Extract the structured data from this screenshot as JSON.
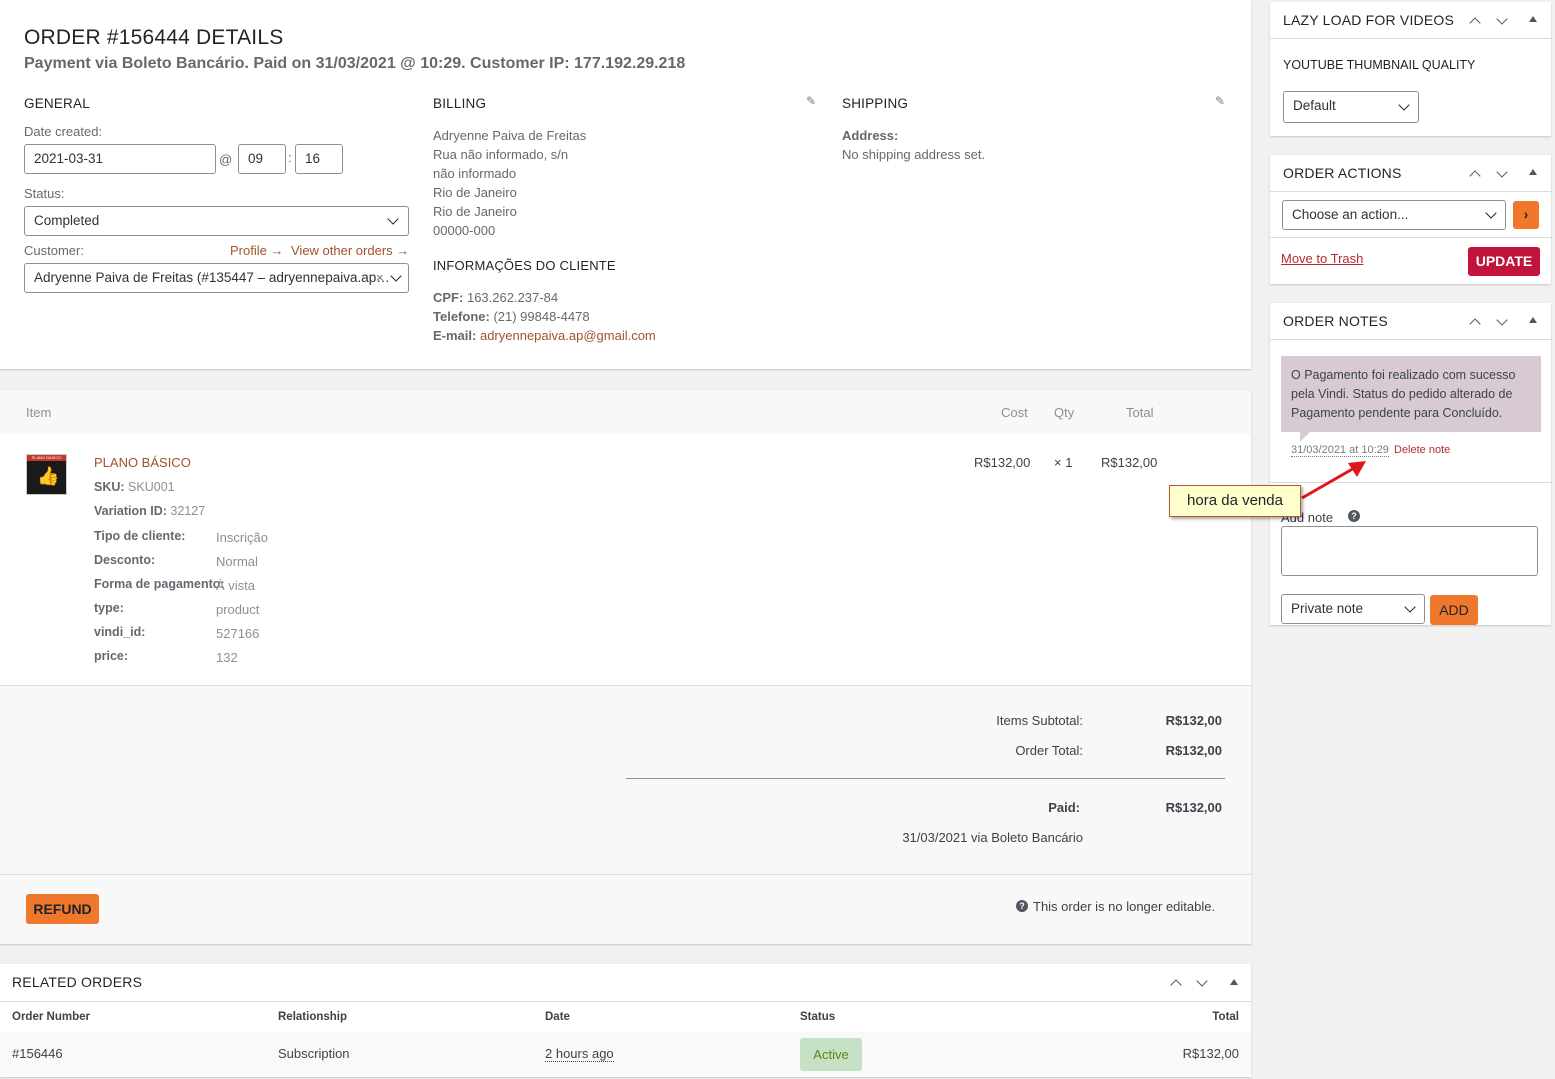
{
  "order": {
    "title": "ORDER #156444 DETAILS",
    "subtitle": "Payment via Boleto Bancário. Paid on 31/03/2021 @ 10:29. Customer IP: 177.192.29.218"
  },
  "general": {
    "heading": "GENERAL",
    "date_label": "Date created:",
    "date_value": "2021-03-31",
    "at": "@",
    "hour": "09",
    "colon": ":",
    "minute": "16",
    "status_label": "Status:",
    "status_value": "Completed",
    "customer_label": "Customer:",
    "profile_link": "Profile →",
    "other_orders_link": "View other orders →",
    "customer_value": "Adryenne Paiva de Freitas (#135447 – adryennepaiva.ap…",
    "clear": "×"
  },
  "billing": {
    "heading": "BILLING",
    "lines": [
      "Adryenne Paiva de Freitas",
      "Rua não informado, s/n",
      "não informado",
      "Rio de Janeiro",
      "Rio de Janeiro",
      "00000-000"
    ],
    "client_heading": "INFORMAÇÕES DO CLIENTE",
    "cpf_label": "CPF:",
    "cpf_value": "163.262.237-84",
    "phone_label": "Telefone:",
    "phone_value": "(21) 99848-4478",
    "email_label": "E-mail:",
    "email_value": "adryennepaiva.ap@gmail.com"
  },
  "shipping": {
    "heading": "SHIPPING",
    "address_label": "Address:",
    "address_value": "No shipping address set."
  },
  "items": {
    "headers": {
      "item": "Item",
      "cost": "Cost",
      "qty": "Qty",
      "total": "Total"
    },
    "product": {
      "name": "PLANO BÁSICO",
      "thumb_text": "PLANO BÁSICO",
      "sku_label": "SKU:",
      "sku": "SKU001",
      "variation_label": "Variation ID:",
      "variation": "32127",
      "cost": "R$132,00",
      "qty": "× 1",
      "total": "R$132,00",
      "meta": [
        {
          "key": "Tipo de cliente:",
          "value": "Inscrição"
        },
        {
          "key": "Desconto:",
          "value": "Normal"
        },
        {
          "key": "Forma de pagamento:",
          "value": "À vista"
        },
        {
          "key": "type:",
          "value": "product"
        },
        {
          "key": "vindi_id:",
          "value": "527166"
        },
        {
          "key": "price:",
          "value": "132"
        }
      ]
    },
    "totals": {
      "subtotal_label": "Items Subtotal:",
      "subtotal": "R$132,00",
      "order_total_label": "Order Total:",
      "order_total": "R$132,00",
      "paid_label": "Paid:",
      "paid": "R$132,00",
      "paid_note": "31/03/2021 via Boleto Bancário"
    },
    "refund_label": "REFUND",
    "not_editable": "This order is no longer editable."
  },
  "related": {
    "heading": "RELATED ORDERS",
    "headers": {
      "number": "Order Number",
      "relationship": "Relationship",
      "date": "Date",
      "status": "Status",
      "total": "Total"
    },
    "row": {
      "number": "#156446",
      "relationship": "Subscription",
      "date": "2 hours ago",
      "status": "Active",
      "total": "R$132,00"
    }
  },
  "sidebar": {
    "lazy": {
      "heading": "LAZY LOAD FOR VIDEOS",
      "label": "YOUTUBE THUMBNAIL QUALITY",
      "value": "Default"
    },
    "actions": {
      "heading": "ORDER ACTIONS",
      "select": "Choose an action...",
      "trash": "Move to Trash",
      "update": "UPDATE"
    },
    "notes": {
      "heading": "ORDER NOTES",
      "note_text": "O Pagamento foi realizado com sucesso pela Vindi. Status do pedido alterado de Pagamento pendente para Concluído.",
      "note_time": "31/03/2021 at 10:29",
      "delete": "Delete note",
      "add_label": "Add note",
      "type": "Private note",
      "add_btn": "ADD"
    }
  },
  "annotation": {
    "callout": "hora da venda",
    "arrow_color": "#e0161c"
  },
  "colors": {
    "link": "#a0522d",
    "orange": "#f0782d",
    "update": "#c0143c",
    "note_bg": "#d7cad2",
    "active_bg": "#c6e1c6"
  }
}
